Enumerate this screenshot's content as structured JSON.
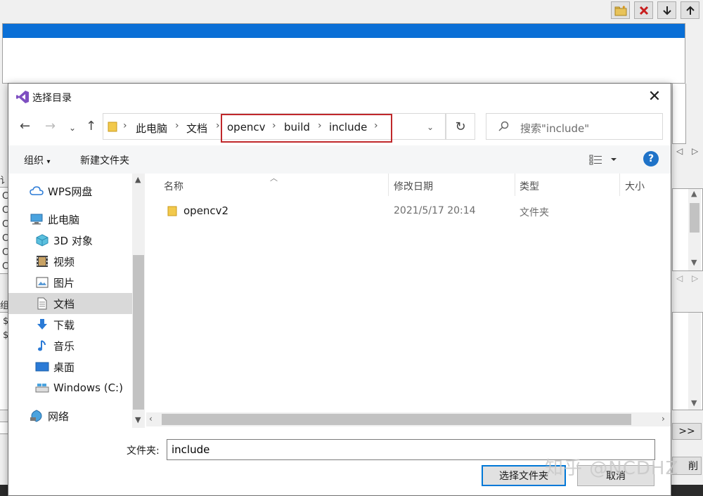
{
  "background": {
    "edge_letters_left": [
      "讠",
      "C",
      "C",
      "C",
      "C",
      "C",
      "C"
    ],
    "edge_label_group": "组",
    "edge_dollar": [
      "$",
      "$"
    ],
    "right_button": ">>",
    "right_button2": "削"
  },
  "dialog": {
    "title": "选择目录",
    "close_icon": "close-icon",
    "breadcrumb": [
      "此电脑",
      "文档",
      "opencv",
      "build",
      "include"
    ],
    "search_placeholder": "搜索\"include\"",
    "toolbar": {
      "organize": "组织",
      "new_folder": "新建文件夹",
      "help": "?"
    },
    "nav_items": [
      {
        "label": "WPS网盘",
        "icon": "cloud-icon"
      },
      {
        "label": "此电脑",
        "icon": "computer-icon"
      },
      {
        "label": "3D 对象",
        "icon": "cube-icon"
      },
      {
        "label": "视频",
        "icon": "film-icon"
      },
      {
        "label": "图片",
        "icon": "picture-icon"
      },
      {
        "label": "文档",
        "icon": "document-icon",
        "selected": true
      },
      {
        "label": "下载",
        "icon": "download-icon"
      },
      {
        "label": "音乐",
        "icon": "music-icon"
      },
      {
        "label": "桌面",
        "icon": "desktop-icon"
      },
      {
        "label": "Windows (C:)",
        "icon": "drive-icon"
      },
      {
        "label": "网络",
        "icon": "network-icon"
      }
    ],
    "columns": {
      "name": "名称",
      "modified": "修改日期",
      "type": "类型",
      "size": "大小"
    },
    "files": [
      {
        "name": "opencv2",
        "modified": "2021/5/17 20:14",
        "type": "文件夹"
      }
    ],
    "folder_label": "文件夹:",
    "folder_value": "include",
    "ok_label": "选择文件夹",
    "cancel_label": "取消"
  },
  "watermark": "知乎 @NCDHZ",
  "colors": {
    "accent": "#0a6fd6",
    "highlight_box": "#c0282b",
    "help": "#1f73c8"
  }
}
